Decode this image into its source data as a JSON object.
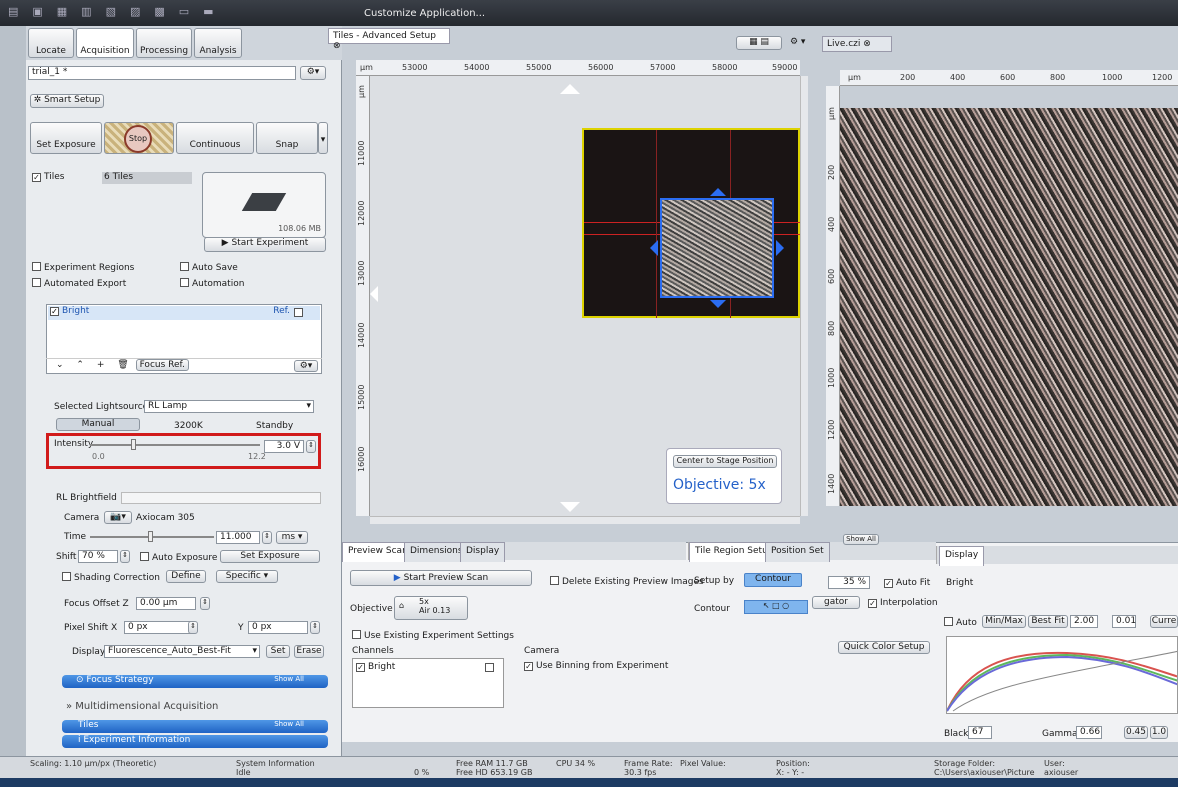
{
  "top_bar": {
    "customize": "Customize Application..."
  },
  "left_tabs": [
    "Locate",
    "Acquisition",
    "Processing",
    "Analysis"
  ],
  "experiment": {
    "name": "trial_1 *"
  },
  "smart_setup": "Smart Setup",
  "acq_buttons": {
    "set_exposure": "Set Exposure",
    "stop": "Stop",
    "continuous": "Continuous",
    "snap": "Snap"
  },
  "tiles": {
    "label": "Tiles",
    "count": "6 Tiles",
    "size": "108.06 MB",
    "start": "Start Experiment"
  },
  "options": {
    "experiment_regions": "Experiment Regions",
    "auto_save": "Auto Save",
    "automated_export": "Automated Export",
    "automation": "Automation"
  },
  "channel_list": {
    "bright": "Bright",
    "ref": "Ref.",
    "focus_ref": "Focus Ref."
  },
  "lightsource": {
    "label": "Selected Lightsource",
    "value": "RL Lamp",
    "manual": "Manual",
    "k3200": "3200K",
    "standby": "Standby",
    "intensity_label": "Intensity",
    "intensity_value": "3.0 V",
    "min": "0.0",
    "max": "12.2",
    "intensity_fraction": 0.24
  },
  "rl": {
    "title": "RL Brightfield",
    "camera_label": "Camera",
    "camera_value": "Axiocam 305",
    "time_label": "Time",
    "time_value": "11.000",
    "time_unit": "ms",
    "shift_label": "Shift",
    "shift_value": "70 %",
    "auto_exposure": "Auto Exposure",
    "set_exposure": "Set Exposure",
    "shading": "Shading Correction",
    "define": "Define",
    "specific": "Specific",
    "focus_offset": "Focus Offset",
    "z": "Z",
    "z_value": "0.00 µm",
    "pixel_shift": "Pixel Shift",
    "x": "X",
    "x_value": "0 px",
    "y": "Y",
    "y_value": "0 px",
    "display": "Display",
    "display_value": "Fluorescence_Auto_Best-Fit",
    "set": "Set",
    "erase": "Erase"
  },
  "sections": {
    "focus_strategy": "Focus Strategy",
    "show_all": "Show All",
    "mda": "Multidimensional Acquisition",
    "tiles": "Tiles",
    "exp_info": "Experiment Information"
  },
  "doc_tabs": {
    "tiles": "Tiles - Advanced Setup",
    "live": "Live.czi"
  },
  "tiles_ruler": {
    "unit": "µm",
    "x_ticks": [
      "53000",
      "54000",
      "55000",
      "56000",
      "57000",
      "58000",
      "59000"
    ],
    "y_ticks": [
      "11000",
      "12000",
      "13000",
      "14000",
      "15000",
      "16000"
    ]
  },
  "live_ruler": {
    "unit": "µm",
    "x_ticks": [
      "200",
      "400",
      "600",
      "800",
      "1000",
      "1200"
    ],
    "y_ticks": [
      "200",
      "400",
      "600",
      "800",
      "1000",
      "1200",
      "1400"
    ]
  },
  "overlay": {
    "center": "Center to Stage Position",
    "objective": "Objective: 5x"
  },
  "bottom_tabs": {
    "preview_scan": "Preview Scan",
    "dimensions": "Dimensions",
    "display": "Display",
    "tile_region": "Tile Region Setup",
    "position_set": "Position Set",
    "display2": "Display",
    "show_all": "Show All"
  },
  "preview": {
    "start": "Start Preview Scan",
    "delete": "Delete Existing Preview Images",
    "objective": "Objective",
    "obj_value": "5x",
    "obj_air": "Air 0.13",
    "use_existing": "Use Existing Experiment Settings",
    "channels": "Channels",
    "camera": "Camera",
    "bright": "Bright",
    "binning": "Use Binning from Experiment"
  },
  "tile_region": {
    "setup_by": "Setup by",
    "contour": "Contour",
    "pct": "35 %",
    "auto_fit": "Auto Fit",
    "contour_label": "Contour",
    "gator": "gator",
    "interpolation": "Interpolation",
    "quick_color": "Quick Color Setup"
  },
  "display_panel": {
    "bright": "Bright",
    "auto": "Auto",
    "minmax": "Min/Max",
    "best_fit": "Best Fit",
    "v1": "2.00",
    "v2": "0.01",
    "curr": "Curre",
    "black": "Black",
    "black_value": "67",
    "gamma": "Gamma",
    "gamma_value": "0.66",
    "g2": "0.45",
    "g3": "1.0"
  },
  "status": {
    "scaling": "Scaling: 1.10 µm/px (Theoretic)",
    "sys_info": "System Information",
    "idle": "Idle",
    "pct0": "0 %",
    "free_ram": "Free RAM 11.7 GB",
    "free_hd": "Free HD 653.19 GB",
    "cpu": "CPU 34 %",
    "frame_rate": "Frame Rate:",
    "fps": "30.3 fps",
    "pixel_value": "Pixel Value:",
    "position": "Position:",
    "xy": "X: -   Y: -",
    "storage": "Storage Folder:",
    "storage_path": "C:\\Users\\axiouser\\Picture",
    "user": "User:",
    "user_name": "axiouser"
  }
}
